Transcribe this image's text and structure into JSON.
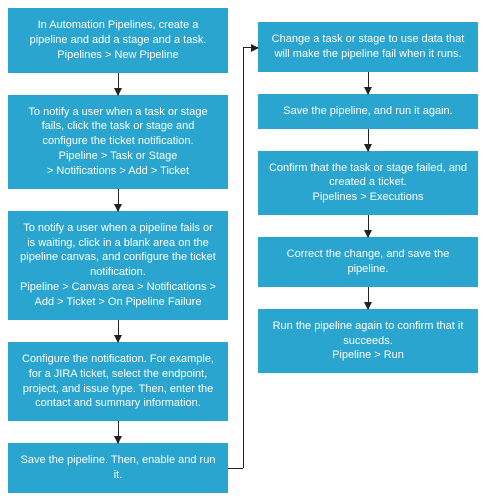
{
  "flow": {
    "left": [
      "In Automation Pipelines, create a pipeline and add a stage and a task.\nPipelines > New Pipeline",
      "To notify a user when a task or stage fails, click the task or stage and configure the ticket notification.\nPipeline > Task or Stage\n> Notifications > Add > Ticket",
      "To notify a user when a pipeline fails or is waiting, click in a blank area on the pipeline canvas, and configure the ticket notification.\nPipeline > Canvas area > Notifications > Add > Ticket > On Pipeline Failure",
      "Configure the notification. For example, for a JIRA ticket, select the endpoint, project, and issue type. Then, enter the contact and summary information.",
      "Save the pipeline. Then, enable and run it."
    ],
    "right": [
      "Change a task or stage to use data that will make the pipeline fail when it runs.",
      "Save the pipeline, and run it again.",
      "Confirm that the task or stage failed, and created a ticket.\nPipelines > Executions",
      "Correct the change, and save the pipeline.",
      "Run the pipeline again to confirm that it succeeds.\nPipeline > Run"
    ]
  },
  "colors": {
    "node": "#2aa5cf",
    "arrow": "#222222"
  }
}
